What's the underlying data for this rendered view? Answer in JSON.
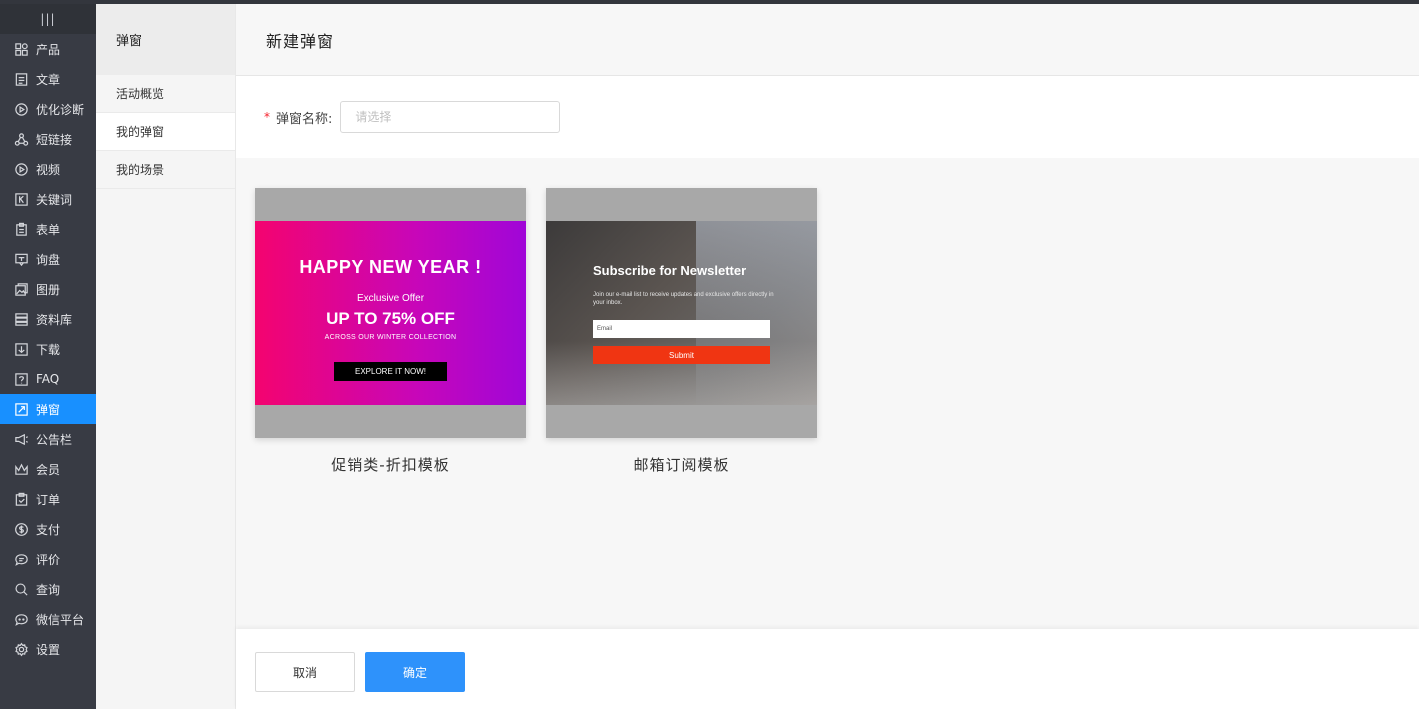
{
  "sidebar": {
    "handle": "|||",
    "items": [
      {
        "label": "产品",
        "icon": "grid-icon"
      },
      {
        "label": "文章",
        "icon": "article-icon"
      },
      {
        "label": "优化诊断",
        "icon": "play-circle-icon"
      },
      {
        "label": "短链接",
        "icon": "share-icon"
      },
      {
        "label": "视频",
        "icon": "video-icon"
      },
      {
        "label": "关键词",
        "icon": "keyword-icon"
      },
      {
        "label": "表单",
        "icon": "form-icon"
      },
      {
        "label": "询盘",
        "icon": "inquiry-icon"
      },
      {
        "label": "图册",
        "icon": "album-icon"
      },
      {
        "label": "资料库",
        "icon": "library-icon"
      },
      {
        "label": "下载",
        "icon": "download-icon"
      },
      {
        "label": "FAQ",
        "icon": "faq-icon"
      },
      {
        "label": "弹窗",
        "icon": "popup-icon",
        "active": true
      },
      {
        "label": "公告栏",
        "icon": "megaphone-icon"
      },
      {
        "label": "会员",
        "icon": "crown-icon"
      },
      {
        "label": "订单",
        "icon": "order-icon"
      },
      {
        "label": "支付",
        "icon": "dollar-icon"
      },
      {
        "label": "评价",
        "icon": "comment-icon"
      },
      {
        "label": "查询",
        "icon": "search-icon"
      },
      {
        "label": "微信平台",
        "icon": "wechat-icon"
      },
      {
        "label": "设置",
        "icon": "gear-icon"
      }
    ]
  },
  "subnav": {
    "title": "弹窗",
    "items": [
      {
        "label": "活动概览"
      },
      {
        "label": "我的弹窗",
        "active": true
      },
      {
        "label": "我的场景"
      }
    ]
  },
  "header": {
    "title": "新建弹窗"
  },
  "form": {
    "required_mark": "*",
    "name_label": "弹窗名称:",
    "name_placeholder": "请选择",
    "name_value": ""
  },
  "templates": [
    {
      "name": "促销类-折扣模板",
      "preview": {
        "title": "HAPPY NEW YEAR !",
        "subtitle": "Exclusive Offer",
        "headline": "UP TO 75% OFF",
        "caption": "ACROSS OUR WINTER COLLECTION",
        "button": "EXPLORE IT NOW!"
      }
    },
    {
      "name": "邮箱订阅模板",
      "preview": {
        "title": "Subscribe for Newsletter",
        "text": "Join our e-mail list to receive updates and exclusive offers directly in your inbox.",
        "input_placeholder": "Email",
        "button": "Submit"
      }
    }
  ],
  "footer": {
    "cancel_label": "取消",
    "ok_label": "确定"
  },
  "colors": {
    "accent": "#1890ff",
    "sidebar_bg": "#383b44",
    "submit_red": "#f03512"
  }
}
